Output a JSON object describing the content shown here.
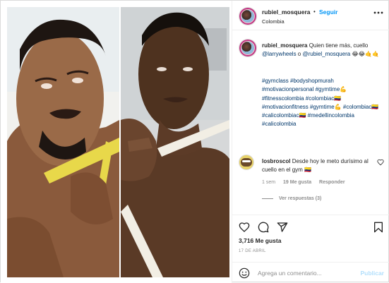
{
  "post": {
    "author": {
      "username": "rubiel_mosquera",
      "separator": "•",
      "follow_label": "Seguir",
      "location": "Colombia"
    },
    "caption": {
      "username": "rubiel_mosquera",
      "text_part1": "Quien tiene más, cuello ",
      "mention1": "@larrywheels",
      "text_part2": " o ",
      "mention2": "@rubiel_mosquera",
      "emojis": " 😂😂🤙🤙",
      "hashtags": "#gymclass #bodyshopmurah #motivacionpersonal #gymtime💪 #fitnesscolombia #colombiac🇨🇴 #motivacionfitness #gymtime💪 #colombiac🇨🇴 #calicolombiac🇨🇴 #medellincolombia #calicolombia"
    },
    "comment": {
      "username": "losbroscol",
      "text": "Desde hoy le meto durísimo al cuello en el gym 🇨🇴",
      "time": "1 sem",
      "likes": "19 Me gusta",
      "reply_label": "Responder",
      "view_replies": "Ver respuestas (3)"
    },
    "likes": "3,716 Me gusta",
    "date": "17 DE ABRIL",
    "add_comment": {
      "placeholder": "Agrega un comentario...",
      "publish_label": "Publicar"
    },
    "icons": {
      "more": "more-horizontal-icon",
      "heart": "heart-icon",
      "comment": "comment-icon",
      "share": "share-icon",
      "save": "bookmark-icon",
      "emoji": "emoji-icon"
    },
    "colors": {
      "link": "#00376b",
      "follow": "#0095f6",
      "muted": "#8e8e8e",
      "publish_disabled": "#b2dffc"
    }
  }
}
